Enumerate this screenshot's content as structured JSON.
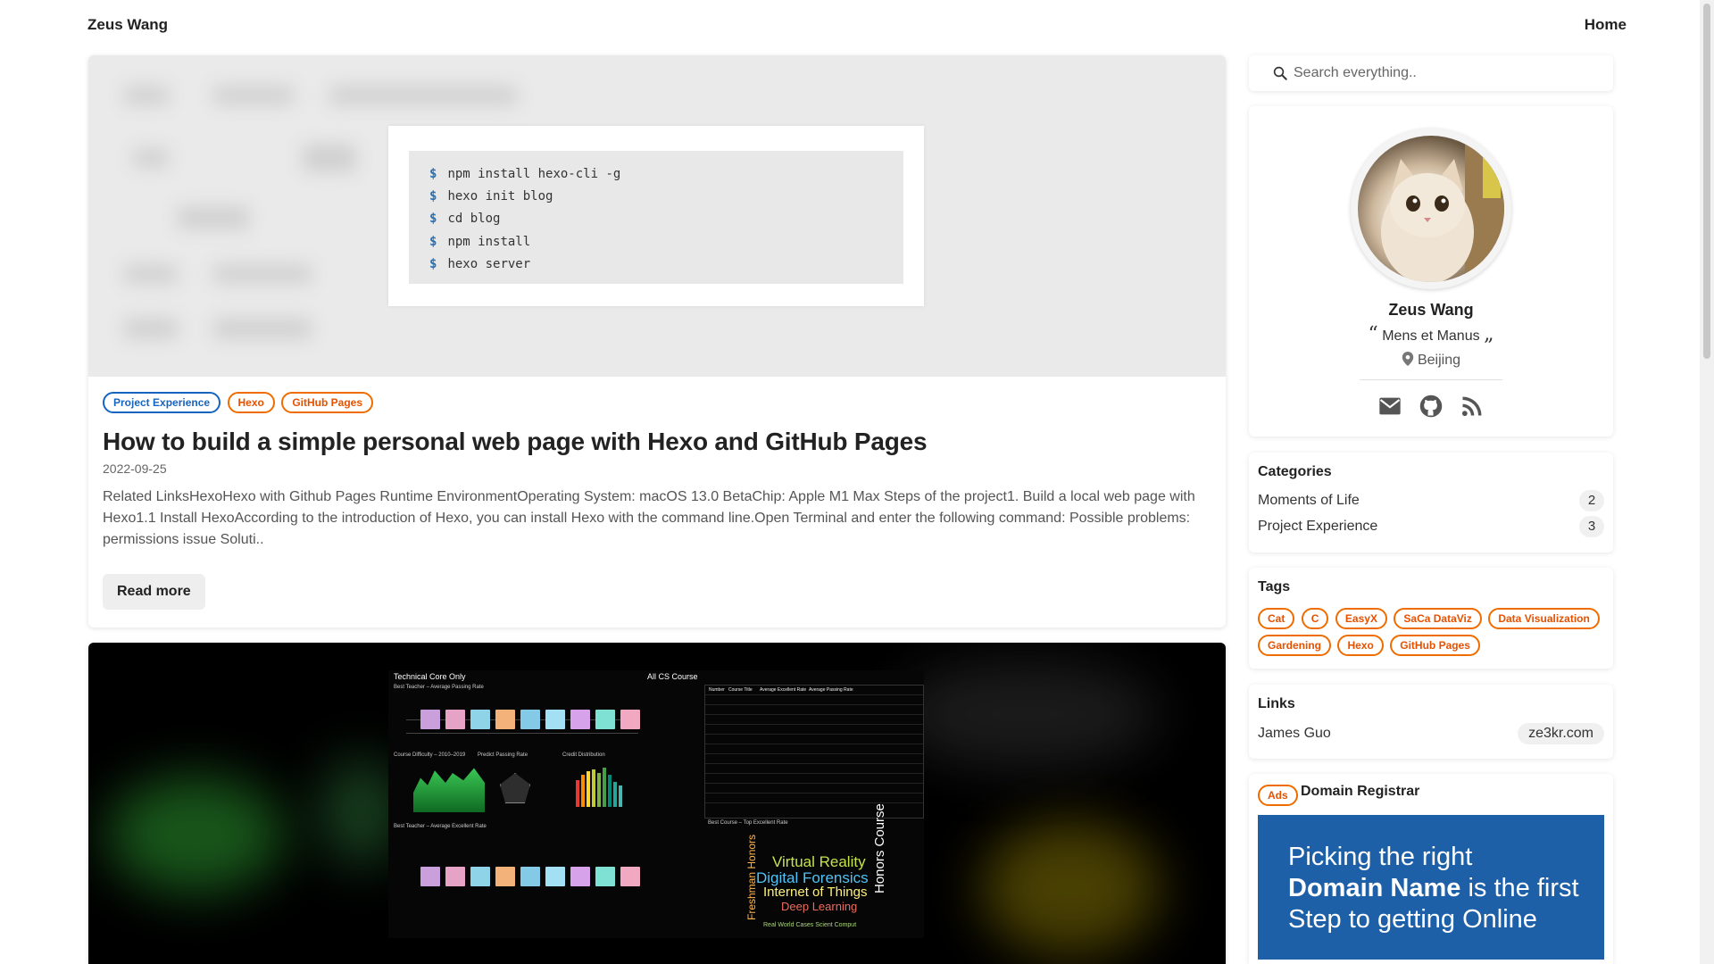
{
  "header": {
    "brand": "Zeus Wang",
    "nav_home": "Home"
  },
  "posts": [
    {
      "tags": [
        "Project Experience",
        "Hexo",
        "GitHub Pages"
      ],
      "title": "How to build a simple personal web page with Hexo and GitHub Pages",
      "date": "2022-09-25",
      "excerpt": "Related LinksHexoHexo with Github Pages Runtime EnvironmentOperating System: macOS 13.0 BetaChip: Apple M1 Max Steps of the project1. Build a local web page with Hexo1.1 Install HexoAccording to the introduction of Hexo, you can install Hexo with the command line.Open Terminal and enter the following command: Possible problems: permissions issue Soluti..",
      "read_more": "Read more",
      "terminal": {
        "prompt": "$",
        "lines": [
          "npm install hexo-cli -g",
          "hexo init blog",
          "cd blog",
          "npm install",
          "hexo server"
        ]
      }
    },
    {
      "dashboard": {
        "title_left": "Technical Core Only",
        "title_right": "All CS Course",
        "sub1": "Best Teacher – Average Passing Rate",
        "sub2": "Course Difficulty – 2010–2019",
        "sub3": "Predict Passing Rate",
        "sub4": "Credit Distribution",
        "sub5": "Best Teacher – Average Excellent Rate",
        "sub6": "Best Course – Top Excellent Rate",
        "col_number": "Number",
        "col_title": "Course Title",
        "col_excellent": "Average Excellent Rate",
        "col_passing": "Average Passing Rate",
        "words": [
          "Virtual Reality",
          "Digital Forensics",
          "Internet of Things",
          "Deep Learning",
          "Honors Course",
          "Freshman Honors",
          "Real World Cases Scient Comput"
        ]
      }
    }
  ],
  "sidebar": {
    "search": {
      "placeholder": "Search everything.."
    },
    "profile": {
      "name": "Zeus Wang",
      "open_quote": "“",
      "motto": "Mens et Manus",
      "close_quote": "„",
      "location": "Beijing"
    },
    "categories": {
      "title": "Categories",
      "items": [
        {
          "label": "Moments of Life",
          "count": "2"
        },
        {
          "label": "Project Experience",
          "count": "3"
        }
      ]
    },
    "tags": {
      "title": "Tags",
      "items": [
        "Cat",
        "C",
        "EasyX",
        "SaCa DataViz",
        "Data Visualization",
        "Gardening",
        "Hexo",
        "GitHub Pages"
      ]
    },
    "links": {
      "title": "Links",
      "items": [
        {
          "label": "James Guo",
          "value": "ze3kr.com"
        }
      ]
    },
    "ads": {
      "badge": "Ads",
      "title": "Domain Registrar",
      "banner_line1": "Picking the right",
      "banner_line2": "Domain Name",
      "banner_line2b": " is the first",
      "banner_line3": "Step to getting Online"
    }
  },
  "colors": {
    "accent_blue": "#1565c0",
    "accent_orange": "#ef6c00",
    "banner_blue": "#1d60a8"
  }
}
